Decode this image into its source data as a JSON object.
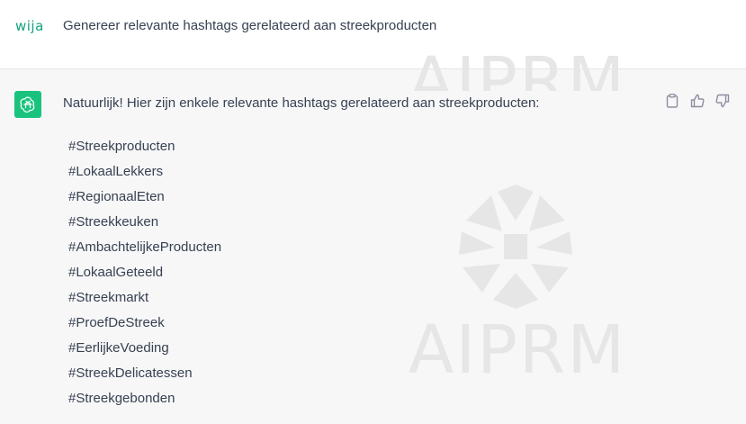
{
  "user_message": {
    "avatar_text": "wija",
    "text": "Genereer relevante hashtags gerelateerd aan streekproducten"
  },
  "assistant_message": {
    "avatar_icon": "chatgpt-logo-icon",
    "intro": "Natuurlijk! Hier zijn enkele relevante hashtags gerelateerd aan streekproducten:",
    "hashtags": [
      "#Streekproducten",
      "#LokaalLekkers",
      "#RegionaalEten",
      "#Streekkeuken",
      "#AmbachtelijkeProducten",
      "#LokaalGeteeld",
      "#Streekmarkt",
      "#ProefDeStreek",
      "#EerlijkeVoeding",
      "#StreekDelicatessen",
      "#Streekgebonden"
    ],
    "actions": [
      "clipboard-icon",
      "thumbs-up-icon",
      "thumbs-down-icon"
    ]
  },
  "watermark": {
    "text": "AIPRM",
    "icon": "aiprm-logo-icon"
  },
  "colors": {
    "accent": "#19c37d",
    "user_avatar": "#10a37f",
    "background": "#f7f7f8"
  }
}
